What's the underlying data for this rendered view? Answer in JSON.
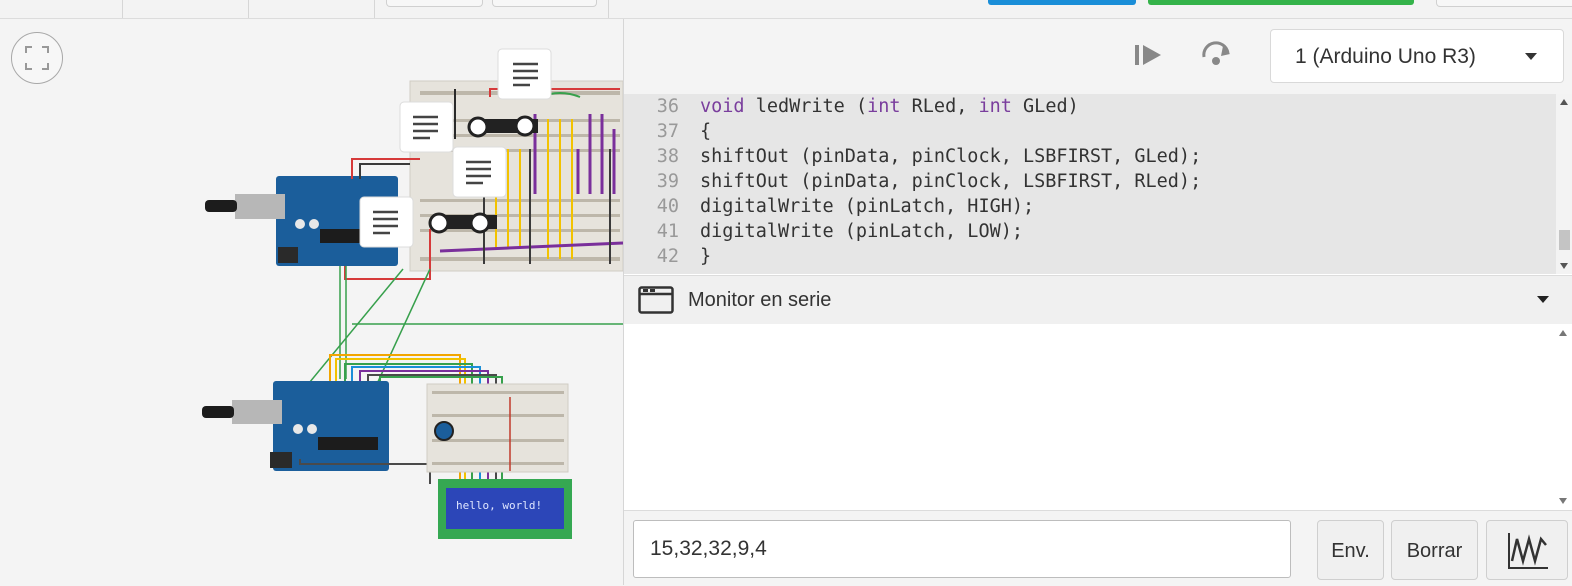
{
  "device_selector": {
    "label": "1 (Arduino Uno R3)"
  },
  "code": {
    "lines": [
      {
        "num": "36",
        "parts": [
          {
            "t": "void",
            "k": 1
          },
          {
            "t": " ledWrite (",
            "k": 0
          },
          {
            "t": "int",
            "k": 1
          },
          {
            "t": " RLed, ",
            "k": 0
          },
          {
            "t": "int",
            "k": 1
          },
          {
            "t": " GLed)",
            "k": 0
          }
        ]
      },
      {
        "num": "37",
        "parts": [
          {
            "t": "{",
            "k": 0
          }
        ]
      },
      {
        "num": "38",
        "parts": [
          {
            "t": "shiftOut (pinData, pinClock, LSBFIRST, GLed);",
            "k": 0
          }
        ]
      },
      {
        "num": "39",
        "parts": [
          {
            "t": "shiftOut (pinData, pinClock, LSBFIRST, RLed);",
            "k": 0
          }
        ]
      },
      {
        "num": "40",
        "parts": [
          {
            "t": "digitalWrite (pinLatch, HIGH);",
            "k": 0
          }
        ]
      },
      {
        "num": "41",
        "parts": [
          {
            "t": "digitalWrite (pinLatch, LOW);",
            "k": 0
          }
        ]
      },
      {
        "num": "42",
        "parts": [
          {
            "t": "}",
            "k": 0
          }
        ]
      }
    ]
  },
  "serial_monitor": {
    "title": "Monitor en serie",
    "input_value": "15,32,32,9,4",
    "send_label": "Env.",
    "clear_label": "Borrar"
  },
  "lcd": {
    "text": "hello, world!"
  },
  "icons": {
    "fit": "fit-view-icon",
    "step": "step-play-icon",
    "restart": "restart-icon",
    "monitor": "serial-monitor-icon",
    "graph": "graph-icon",
    "note": "note-icon"
  },
  "colors": {
    "board": "#1b5e9b",
    "breadboard": "#e6e3dc",
    "lcd_green": "#35a852",
    "lcd_screen": "#2c46b8",
    "keyword": "#7a3e9d",
    "start_button": "#35b34a",
    "code_button": "#1a8ed8"
  }
}
